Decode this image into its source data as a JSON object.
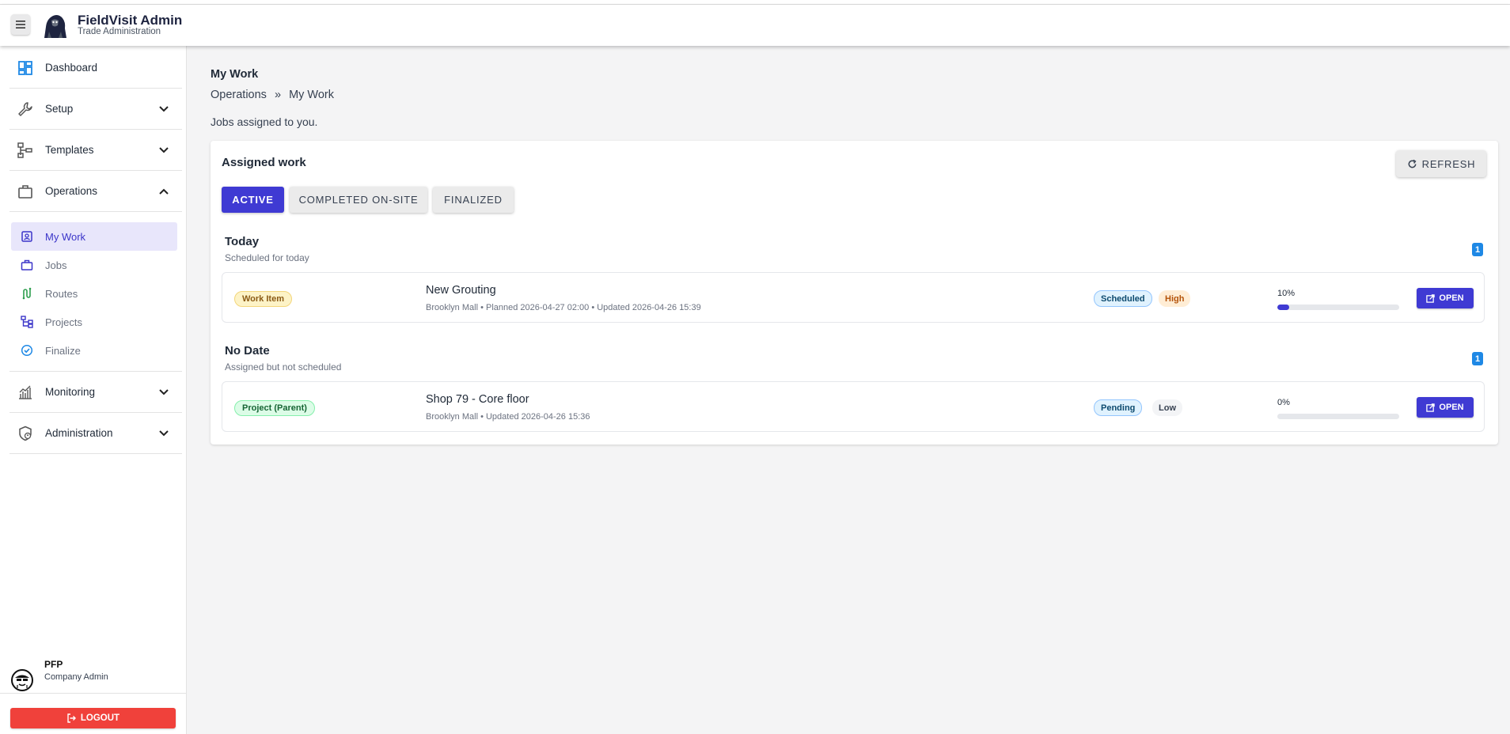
{
  "header": {
    "title": "FieldVisit Admin",
    "subtitle": "Trade Administration"
  },
  "sidebar": {
    "items": [
      {
        "label": "Dashboard",
        "icon": "dashboard-icon"
      },
      {
        "label": "Setup",
        "icon": "wrench-icon",
        "expanded": false
      },
      {
        "label": "Templates",
        "icon": "hierarchy-icon",
        "expanded": false
      },
      {
        "label": "Operations",
        "icon": "briefcase-icon",
        "expanded": true
      },
      {
        "label": "Monitoring",
        "icon": "chart-icon",
        "expanded": false
      },
      {
        "label": "Administration",
        "icon": "shield-user-icon",
        "expanded": false
      }
    ],
    "operations_children": [
      {
        "label": "My Work",
        "icon": "badge-icon",
        "active": true
      },
      {
        "label": "Jobs",
        "icon": "briefcase-icon",
        "active": false
      },
      {
        "label": "Routes",
        "icon": "route-icon",
        "active": false
      },
      {
        "label": "Projects",
        "icon": "tree-icon",
        "active": false
      },
      {
        "label": "Finalize",
        "icon": "check-circle-icon",
        "active": false
      }
    ],
    "user": {
      "name": "PFP",
      "role": "Company Admin"
    },
    "logout_label": "LOGOUT"
  },
  "main": {
    "title": "My Work",
    "breadcrumb": [
      "Operations",
      "»",
      "My Work"
    ],
    "description": "Jobs assigned to you.",
    "card": {
      "title": "Assigned work",
      "refresh_label": "REFRESH",
      "tabs": [
        {
          "label": "ACTIVE",
          "active": true
        },
        {
          "label": "COMPLETED ON-SITE",
          "active": false
        },
        {
          "label": "FINALIZED",
          "active": false
        }
      ],
      "sections": [
        {
          "title": "Today",
          "subtitle": "Scheduled for today",
          "count": "1",
          "rows": [
            {
              "type": "Work Item",
              "title": "New Grouting",
              "meta": "Brooklyn Mall • Planned 2026-04-27 02:00 • Updated 2026-04-26 15:39",
              "status": "Scheduled",
              "priority": "High",
              "progress_label": "10%",
              "progress": 0.1,
              "open_label": "OPEN"
            }
          ]
        },
        {
          "title": "No Date",
          "subtitle": "Assigned but not scheduled",
          "count": "1",
          "rows": [
            {
              "type": "Project (Parent)",
              "title": "Shop 79 - Core floor",
              "meta": "Brooklyn Mall • Updated 2026-04-26 15:36",
              "status": "Pending",
              "priority": "Low",
              "progress_label": "0%",
              "progress": 0.0,
              "open_label": "OPEN"
            }
          ]
        }
      ]
    }
  },
  "colors": {
    "accent": "#3f3ad3",
    "logout": "#f0413b",
    "badge": "#1e88e5"
  }
}
